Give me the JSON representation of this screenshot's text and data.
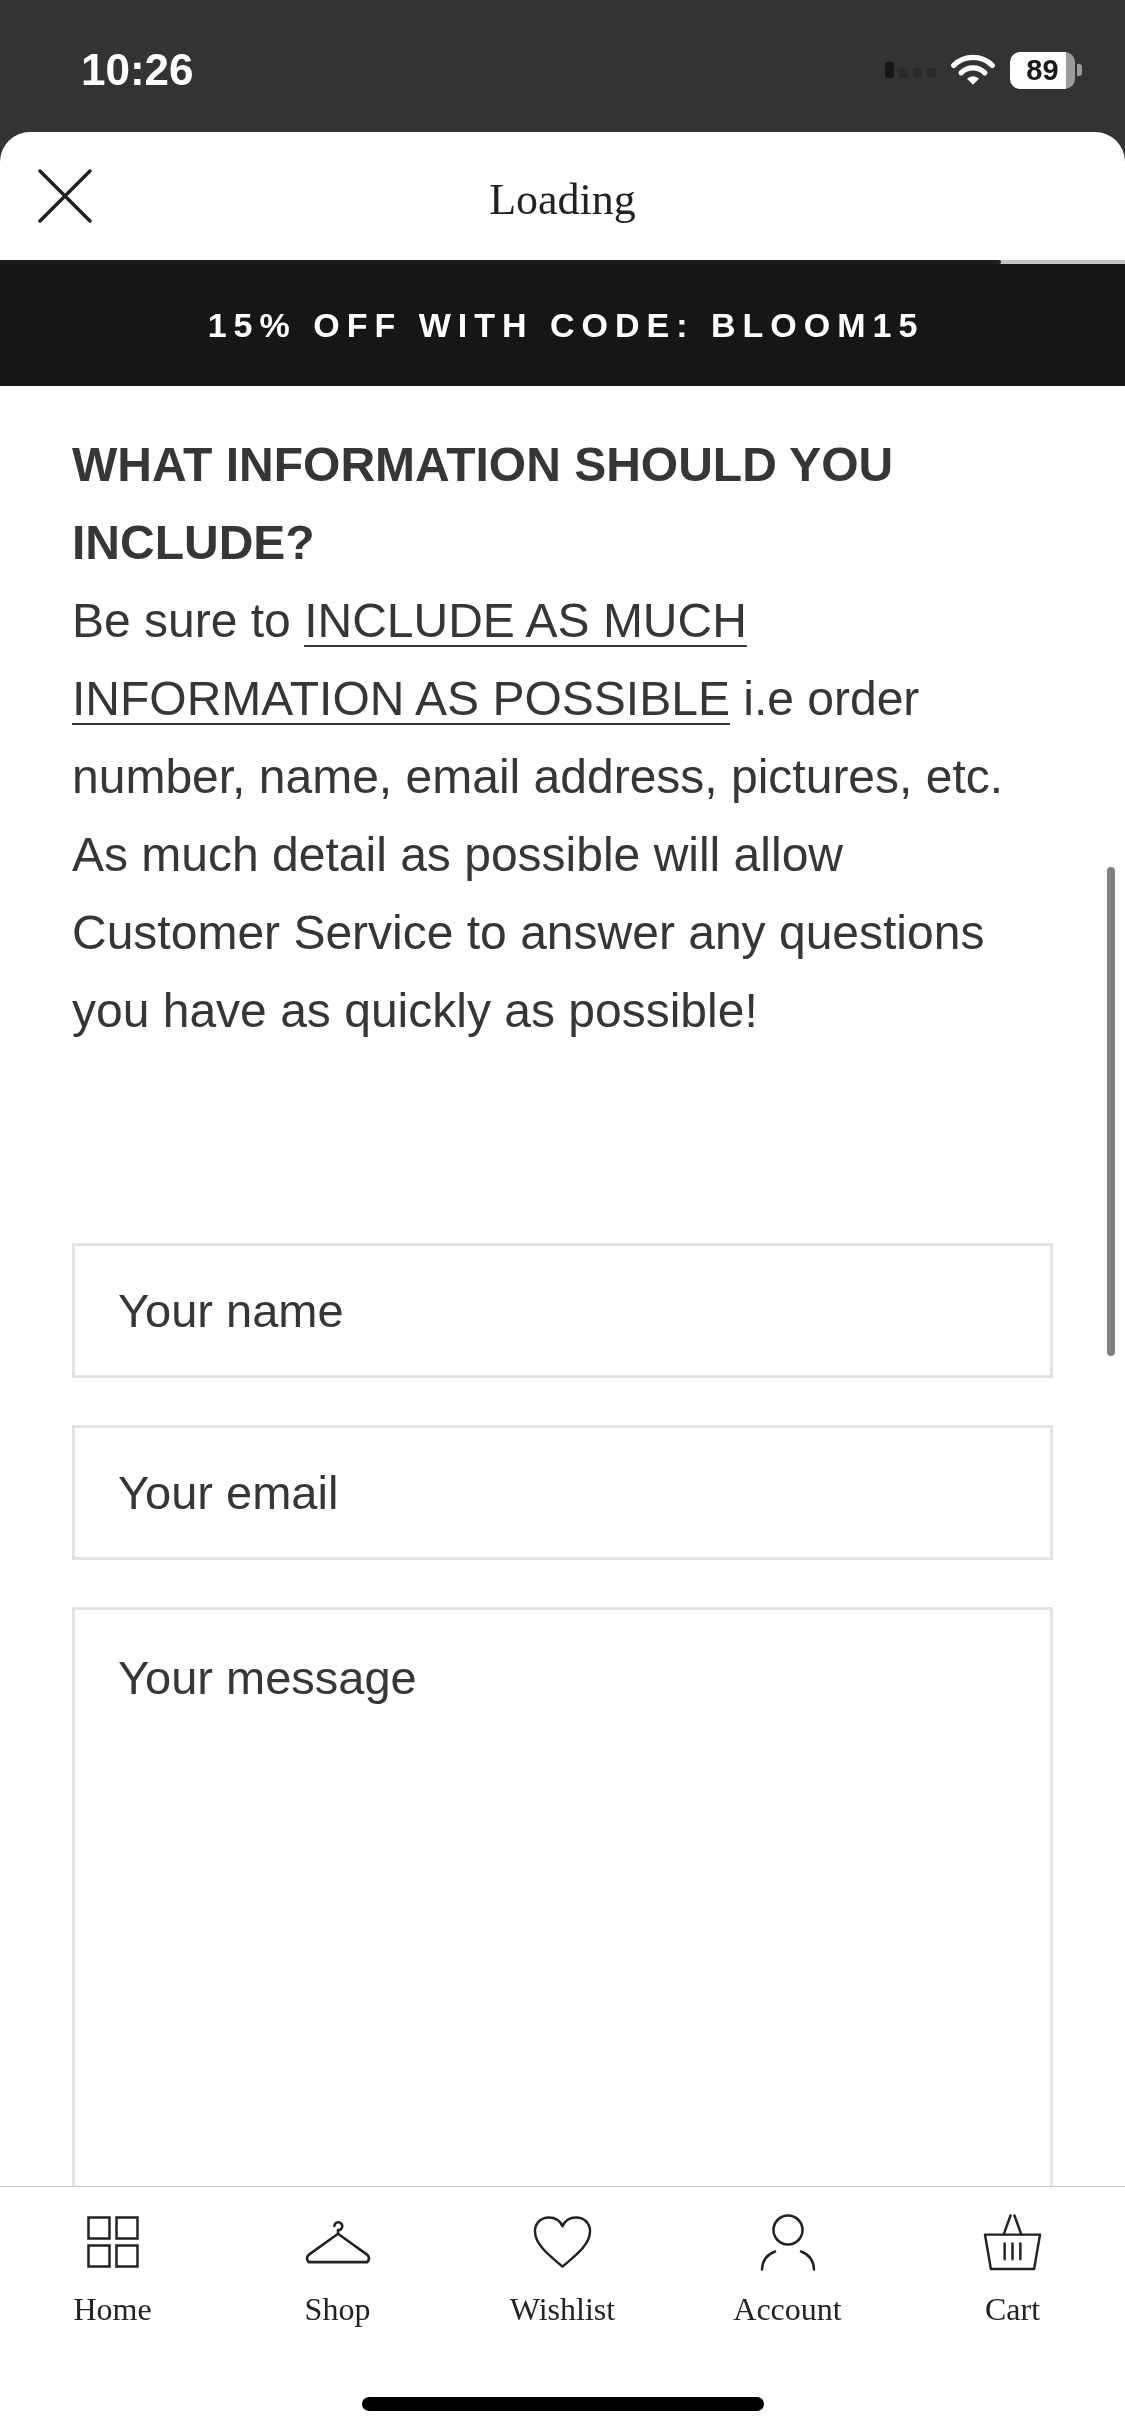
{
  "status_bar": {
    "time": "10:26",
    "battery": "89"
  },
  "header": {
    "title": "Loading",
    "progress": {
      "level": 0.89
    }
  },
  "promo_banner": {
    "text": "15% OFF WITH CODE: BLOOM15"
  },
  "info": {
    "heading": "WHAT INFORMATION SHOULD YOU INCLUDE?",
    "body": [
      {
        "text": "Be sure to ",
        "underline": false
      },
      {
        "text": "INCLUDE AS MUCH INFORMATION AS POSSIBLE",
        "underline": true
      },
      {
        "text": " i.e order number, name, email address, pictures, etc. As much detail as possible will allow Customer Service to answer any questions you have as quickly as possible!",
        "underline": false
      }
    ]
  },
  "form": {
    "fields": [
      {
        "kind": "input",
        "placeholder": "Your name"
      },
      {
        "kind": "input",
        "placeholder": "Your email"
      },
      {
        "kind": "textarea",
        "placeholder": "Your message"
      }
    ]
  },
  "bottom_nav": {
    "items": [
      {
        "label": "Home"
      },
      {
        "label": "Shop"
      },
      {
        "label": "Wishlist"
      },
      {
        "label": "Account"
      },
      {
        "label": "Cart"
      }
    ]
  }
}
